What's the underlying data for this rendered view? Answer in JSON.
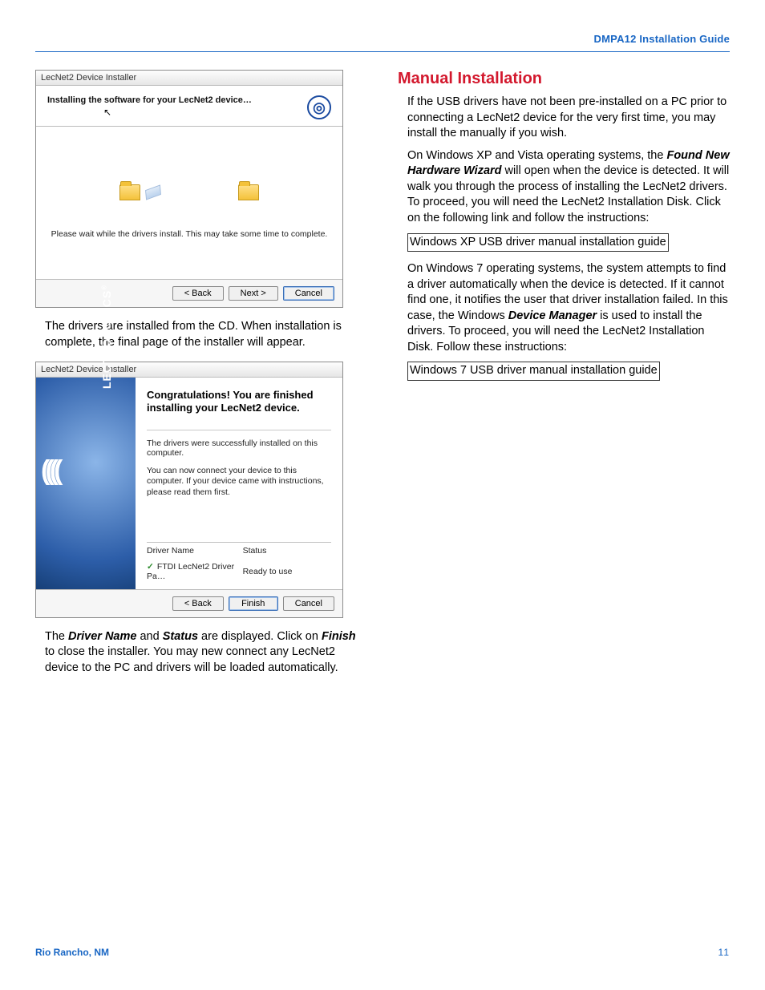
{
  "header": {
    "title": "DMPA12 Installation Guide"
  },
  "win1": {
    "title": "LecNet2 Device Installer",
    "installing_label": "Installing the software for your LecNet2 device…",
    "wait_msg": "Please wait while the drivers install. This may take some time to complete.",
    "back": "< Back",
    "next": "Next >",
    "cancel": "Cancel"
  },
  "left": {
    "p1": "The drivers are installed from the CD. When installation is complete, the final page of the installer will appear.",
    "p2_a": "The ",
    "p2_b": "Driver Name",
    "p2_c": " and ",
    "p2_d": "Status",
    "p2_e": " are displayed. Click on ",
    "p2_f": "Finish",
    "p2_g": " to close the installer. You may new connect any LecNet2 device to the PC and drivers will be loaded automatically."
  },
  "win2": {
    "title": "LecNet2 Device Installer",
    "side_brand": "LECTROSONICS",
    "side_tm": "®",
    "congrats": "Congratulations! You are finished installing your LecNet2 device.",
    "sub1": "The drivers were successfully installed on this computer.",
    "sub2": "You can now connect your device to this computer. If your device came with instructions, please read them first.",
    "col_driver": "Driver Name",
    "col_status": "Status",
    "row_driver": "FTDI LecNet2 Driver Pa…",
    "row_status": "Ready to use",
    "back": "< Back",
    "finish": "Finish",
    "cancel": "Cancel"
  },
  "right": {
    "h": "Manual Installation",
    "p1": "If the USB drivers have not been pre-installed on a PC prior to connecting a LecNet2 device for the very first time, you may install the manually if you wish.",
    "p2_a": "On Windows XP and Vista operating systems, the ",
    "p2_b": "Found New Hardware Wizard",
    "p2_c": " will open when the device is detected. It will walk you through the process of installing the LecNet2 drivers. To proceed, you will need the LecNet2 Installation Disk. Click on the following link and follow the instructions:",
    "link1": "Windows XP USB driver manual installation guide",
    "p3_a": "On Windows 7 operating systems, the system attempts to find a driver automatically when the device is detected. If it cannot find one, it notifies the user that driver installation failed. In this case, the Windows ",
    "p3_b": "Device Manager",
    "p3_c": " is used to install the drivers. To proceed, you will need the LecNet2 Installation Disk. Follow these instructions:",
    "link2": "Windows 7 USB driver manual installation guide"
  },
  "footer": {
    "left": "Rio Rancho, NM",
    "right": "11"
  }
}
